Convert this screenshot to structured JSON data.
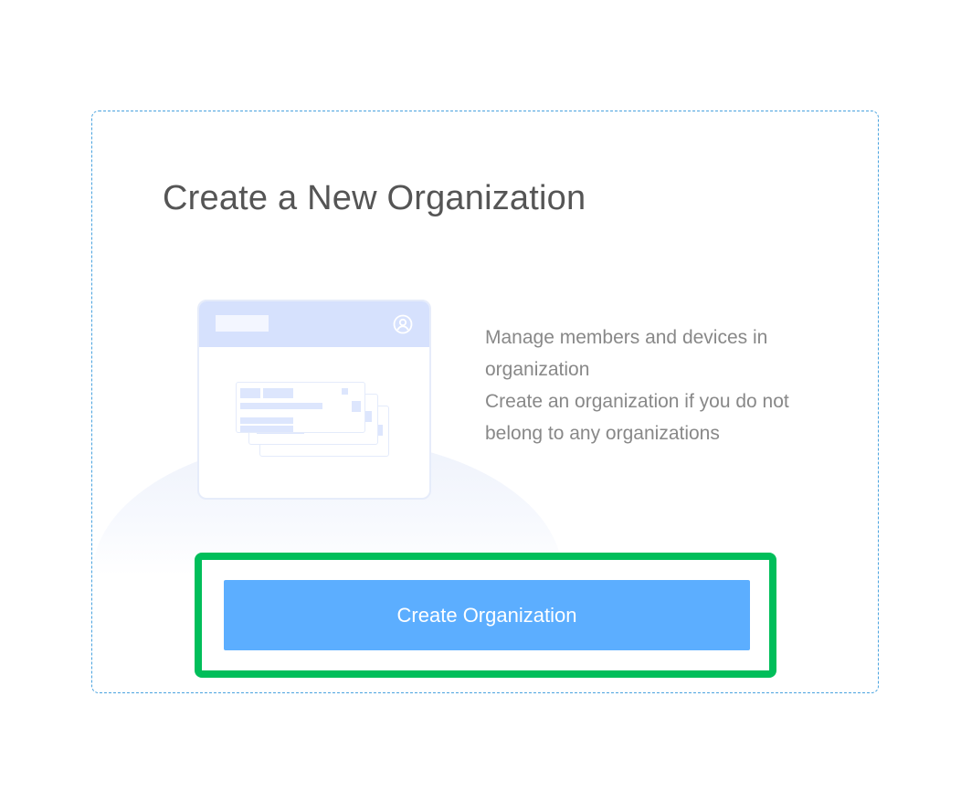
{
  "page": {
    "title": "Create a New Organization"
  },
  "description": {
    "line1": "Manage members and devices in organization",
    "line2": "Create an organization if you do not belong to any organizations"
  },
  "actions": {
    "create_label": "Create Organization"
  },
  "illustration": {
    "icon": "user-circle-icon"
  },
  "colors": {
    "button_bg": "#5caeff",
    "highlight_border": "#00be5a",
    "card_border": "#4aa3df",
    "title_text": "#555555",
    "description_text": "#888888"
  }
}
